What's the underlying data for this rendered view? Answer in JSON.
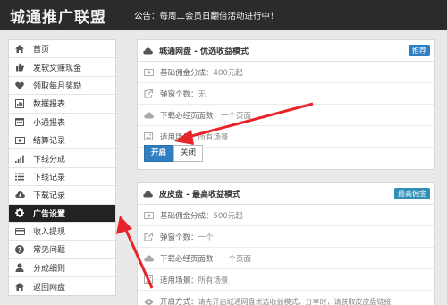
{
  "header": {
    "logo": "城通推广联盟",
    "notice": "公告：每周二会员日翻倍活动进行中！"
  },
  "sidebar": {
    "items": [
      {
        "label": "首页",
        "icon": "home-icon"
      },
      {
        "label": "发软文赚现金",
        "icon": "thumbs-up-icon"
      },
      {
        "label": "领取每月奖励",
        "icon": "heart-icon"
      },
      {
        "label": "数据报表",
        "icon": "chart-icon"
      },
      {
        "label": "小通报表",
        "icon": "calendar-icon"
      },
      {
        "label": "结算记录",
        "icon": "money-icon"
      },
      {
        "label": "下线分成",
        "icon": "signal-icon"
      },
      {
        "label": "下线记录",
        "icon": "list-icon"
      },
      {
        "label": "下载记录",
        "icon": "cloud-download-icon"
      },
      {
        "label": "广告设置",
        "icon": "gear-icon",
        "active": true
      },
      {
        "label": "收入提现",
        "icon": "credit-card-icon"
      },
      {
        "label": "常见问题",
        "icon": "question-icon"
      },
      {
        "label": "分成细则",
        "icon": "user-icon"
      },
      {
        "label": "返回网盘",
        "icon": "home-icon"
      }
    ]
  },
  "panel1": {
    "title": "城通网盘 - 优选收益模式",
    "badge": "推荐",
    "rows": [
      {
        "label": "基础佣金分成：",
        "value": "400元起",
        "icon": "money-icon"
      },
      {
        "label": "弹窗个数：",
        "value": "无",
        "icon": "external-link-icon"
      },
      {
        "label": "下载必经页面数：",
        "value": "一个页面",
        "icon": "cloud-icon"
      },
      {
        "label": "适用场景：",
        "value": "所有场景",
        "icon": "image-icon"
      }
    ],
    "open_label": "开启",
    "close_label": "关闭"
  },
  "panel2": {
    "title": "皮皮盘 - 最高收益模式",
    "badge": "最高佣金",
    "rows": [
      {
        "label": "基础佣金分成：",
        "value": "500元起",
        "icon": "money-icon"
      },
      {
        "label": "弹窗个数：",
        "value": "一个",
        "icon": "external-link-icon"
      },
      {
        "label": "下载必经页面数：",
        "value": "一个页面",
        "icon": "cloud-icon"
      },
      {
        "label": "适用场景：",
        "value": "所有场景",
        "icon": "image-icon"
      },
      {
        "label": "开启方式：",
        "value": "请先开启城通网盘优选收益模式，分享时，请获取皮皮盘链接",
        "icon": "eye-icon"
      }
    ]
  },
  "colors": {
    "header_bg": "#2b2b2b",
    "accent_blue": "#2f7ec0",
    "arrow_red": "#e8242a",
    "active_bg": "#222222"
  }
}
